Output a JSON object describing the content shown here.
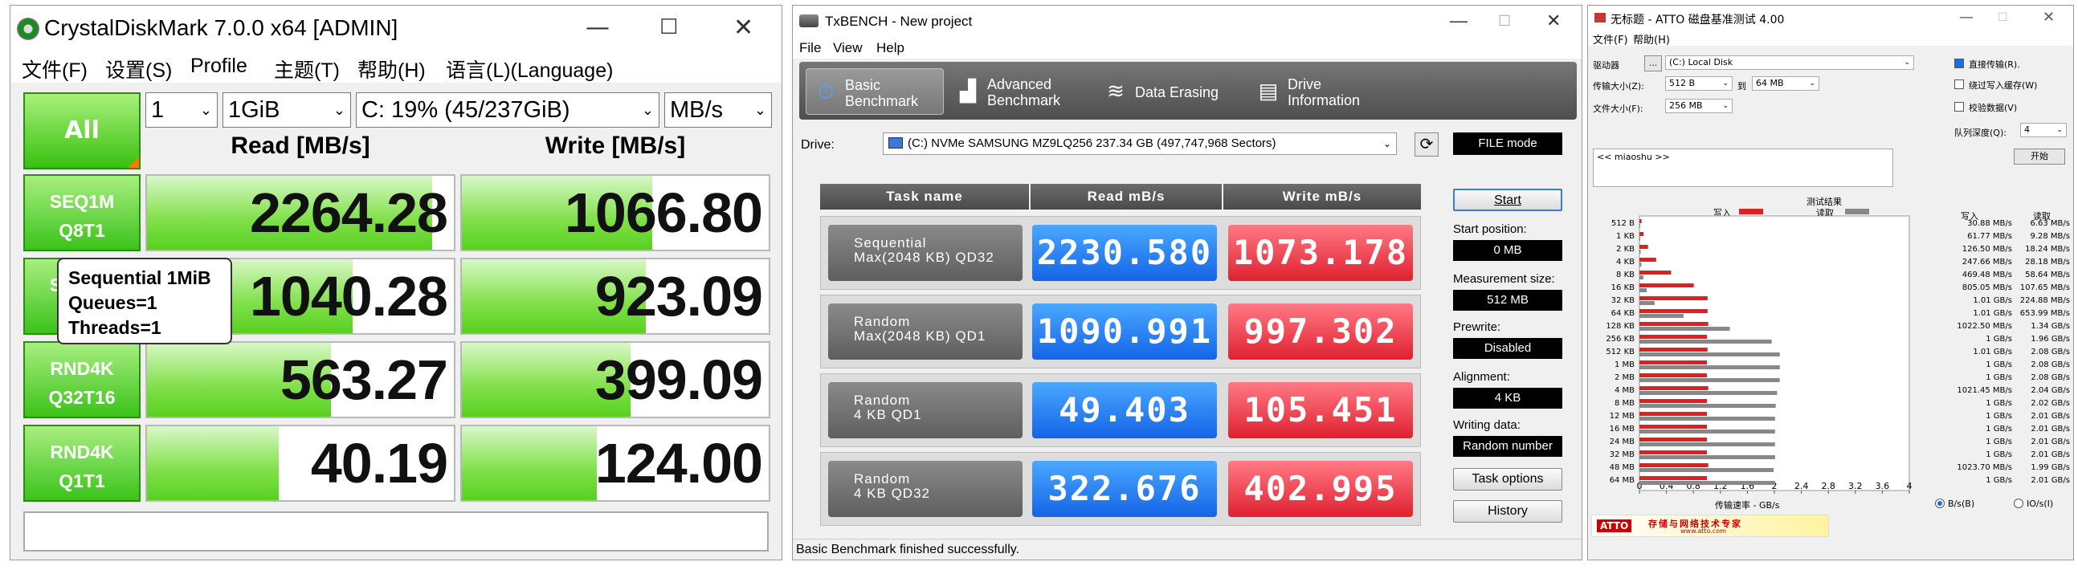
{
  "cdm": {
    "title": "CrystalDiskMark 7.0.0 x64 [ADMIN]",
    "win_min": "—",
    "win_max": "☐",
    "win_close": "✕",
    "menu": [
      "文件(F)",
      "设置(S)",
      "Profile",
      "主题(T)",
      "帮助(H)",
      "语言(L)(Language)"
    ],
    "all_label": "All",
    "count": "1",
    "size": "1GiB",
    "drive": "C: 19% (45/237GiB)",
    "unit": "MB/s",
    "read_header": "Read [MB/s]",
    "write_header": "Write [MB/s]",
    "rows": [
      {
        "l1": "SEQ1M",
        "l2": "Q8T1",
        "read": "2264.28",
        "write": "1066.80",
        "read_frac": 0.93,
        "write_frac": 0.62
      },
      {
        "l1": "SEQ1M",
        "l2": "Q1T1",
        "read": "1040.28",
        "write": "923.09",
        "read_frac": 0.67,
        "write_frac": 0.6
      },
      {
        "l1": "RND4K",
        "l2": "Q32T16",
        "read": "563.27",
        "write": "399.09",
        "read_frac": 0.6,
        "write_frac": 0.55
      },
      {
        "l1": "RND4K",
        "l2": "Q1T1",
        "read": "40.19",
        "write": "124.00",
        "read_frac": 0.43,
        "write_frac": 0.44
      }
    ],
    "tooltip": [
      "Sequential 1MiB",
      "Queues=1",
      "Threads=1"
    ]
  },
  "tx": {
    "title": "TxBENCH - New project",
    "win_min": "—",
    "win_max": "☐",
    "win_close": "✕",
    "menu": [
      "File",
      "View",
      "Help"
    ],
    "tabs": [
      {
        "l1": "Basic",
        "l2": "Benchmark"
      },
      {
        "l1": "Advanced",
        "l2": "Benchmark"
      },
      {
        "l1": "Data Erasing",
        "l2": ""
      },
      {
        "l1": "Drive",
        "l2": "Information"
      }
    ],
    "drive_label": "Drive:",
    "drive_value": "(C:) NVMe SAMSUNG MZ9LQ256  237.34 GB (497,747,968 Sectors)",
    "file_mode": "FILE mode",
    "headers": [
      "Task name",
      "Read mB/s",
      "Write mB/s"
    ],
    "rows": [
      {
        "n1": "Sequential",
        "n2": "Max(2048 KB) QD32",
        "read": "2230.580",
        "write": "1073.178"
      },
      {
        "n1": "Random",
        "n2": "Max(2048 KB) QD1",
        "read": "1090.991",
        "write": "997.302"
      },
      {
        "n1": "Random",
        "n2": "4 KB QD1",
        "read": "49.403",
        "write": "105.451"
      },
      {
        "n1": "Random",
        "n2": "4 KB QD32",
        "read": "322.676",
        "write": "402.995"
      }
    ],
    "start": "Start",
    "start_pos_label": "Start position:",
    "start_pos": "0 MB",
    "meas_label": "Measurement size:",
    "meas": "512 MB",
    "prewrite_label": "Prewrite:",
    "prewrite": "Disabled",
    "align_label": "Alignment:",
    "align": "4 KB",
    "wdata_label": "Writing data:",
    "wdata": "Random number",
    "task_options": "Task options",
    "history": "History",
    "status": "Basic Benchmark finished successfully."
  },
  "atto": {
    "title": "无标题 - ATTO 磁盘基准测试 4.00",
    "win_min": "—",
    "win_max": "☐",
    "win_close": "✕",
    "menu": [
      "文件(F)",
      "帮助(H)"
    ],
    "drive_label": "驱动器",
    "drive_btn": "...",
    "drive": "(C:) Local Disk",
    "xfer_label": "传输大小(Z):",
    "xfer_from": "512 B",
    "xfer_to_label": "到",
    "xfer_to": "64 MB",
    "file_label": "文件大小(F):",
    "file_size": "256 MB",
    "chk_direct": "直接传输(R).",
    "chk_bypass": "绕过写入缓存(W)",
    "chk_verify": "校验数据(V)",
    "qd_label": "队列深度(Q):",
    "qd": "4",
    "start": "开始",
    "comment": "<< miaoshu >>",
    "results_title": "测试结果",
    "legend_write": "写入",
    "legend_read": "读取",
    "col_write": "写入",
    "col_read": "读取",
    "x_label": "传输速率 - GB/s",
    "x_ticks": [
      "0",
      "0.4",
      "0.8",
      "1.2",
      "1.6",
      "2",
      "2.4",
      "2.8",
      "3.2",
      "3.6",
      "4"
    ],
    "unit_bs": "B/s(B)",
    "unit_io": "IO/s(I)",
    "footer_logo": "ATTO",
    "footer_text": "存储与网络技术专家",
    "footer_url": "www.atto.com",
    "colors": {
      "write": "#e02020",
      "read": "#888888"
    }
  },
  "chart_data": {
    "type": "bar",
    "title": "测试结果",
    "xlabel": "传输速率 - GB/s",
    "xlim": [
      0,
      4
    ],
    "categories": [
      "512 B",
      "1 KB",
      "2 KB",
      "4 KB",
      "8 KB",
      "16 KB",
      "32 KB",
      "64 KB",
      "128 KB",
      "256 KB",
      "512 KB",
      "1 MB",
      "2 MB",
      "4 MB",
      "8 MB",
      "12 MB",
      "16 MB",
      "24 MB",
      "32 MB",
      "48 MB",
      "64 MB"
    ],
    "series": [
      {
        "name": "写入",
        "values": [
          0.031,
          0.062,
          0.127,
          0.248,
          0.469,
          0.805,
          1.01,
          1.01,
          1.02,
          1,
          1.01,
          1,
          1,
          1.02,
          1,
          1,
          1,
          1,
          1,
          1.02,
          1
        ],
        "labels": [
          "30.88 MB/s",
          "61.77 MB/s",
          "126.50 MB/s",
          "247.66 MB/s",
          "469.48 MB/s",
          "805.05 MB/s",
          "1.01 GB/s",
          "1.01 GB/s",
          "1022.50 MB/s",
          "1 GB/s",
          "1.01 GB/s",
          "1 GB/s",
          "1 GB/s",
          "1021.45 MB/s",
          "1 GB/s",
          "1 GB/s",
          "1 GB/s",
          "1 GB/s",
          "1 GB/s",
          "1023.70 MB/s",
          "1 GB/s"
        ]
      },
      {
        "name": "读取",
        "values": [
          0.007,
          0.009,
          0.018,
          0.028,
          0.059,
          0.108,
          0.225,
          0.654,
          1.34,
          1.96,
          2.08,
          2.08,
          2.08,
          2.04,
          2.02,
          2.01,
          2.01,
          2.01,
          2.01,
          1.99,
          2.01
        ],
        "labels": [
          "6.63 MB/s",
          "9.28 MB/s",
          "18.24 MB/s",
          "28.18 MB/s",
          "58.64 MB/s",
          "107.65 MB/s",
          "224.88 MB/s",
          "653.99 MB/s",
          "1.34 GB/s",
          "1.96 GB/s",
          "2.08 GB/s",
          "2.08 GB/s",
          "2.08 GB/s",
          "2.04 GB/s",
          "2.02 GB/s",
          "2.01 GB/s",
          "2.01 GB/s",
          "2.01 GB/s",
          "2.01 GB/s",
          "1.99 GB/s",
          "2.01 GB/s"
        ]
      }
    ]
  }
}
